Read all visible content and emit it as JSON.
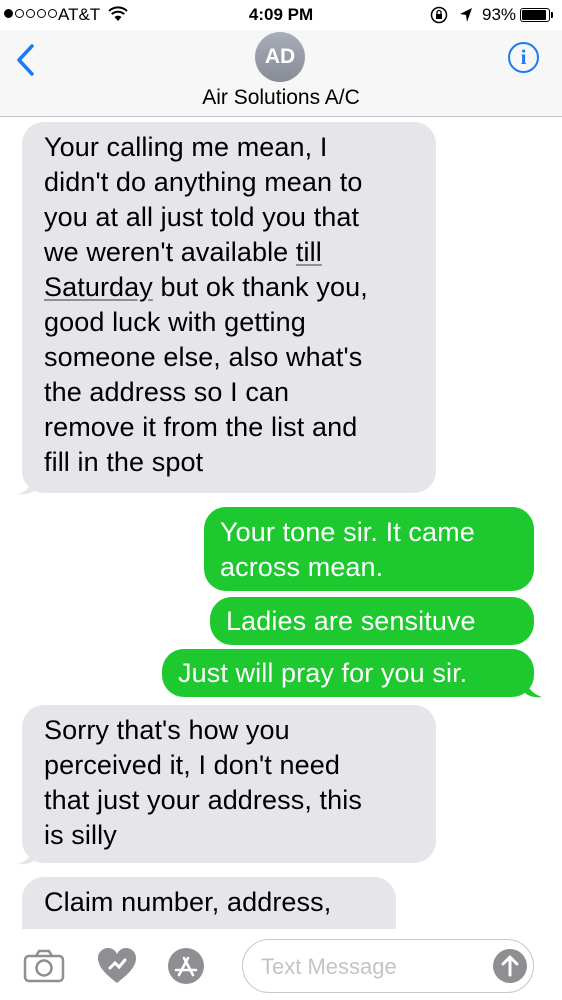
{
  "status_bar": {
    "carrier": "AT&T",
    "time": "4:09 PM",
    "battery_percent": "93%",
    "battery_level": 0.93,
    "signal_bars": 1
  },
  "header": {
    "avatar_initials": "AD",
    "contact_name": "Air Solutions A/C",
    "info_label": "i"
  },
  "messages": [
    {
      "direction": "incoming",
      "lines": [
        "Your calling me mean, I",
        "didn't do anything mean to",
        "you at all just told you that",
        "we weren't available till",
        "Saturday but ok thank you,",
        "good luck with getting",
        "someone else, also what's",
        "the address so I can",
        "remove it from the list and",
        "fill in the spot"
      ],
      "detected_date_text": "till Saturday"
    },
    {
      "direction": "outgoing",
      "lines": [
        "Your tone sir. It came",
        "across mean."
      ]
    },
    {
      "direction": "outgoing",
      "lines": [
        "Ladies are sensituve"
      ]
    },
    {
      "direction": "outgoing",
      "lines": [
        "Just will pray for you sir."
      ]
    },
    {
      "direction": "incoming",
      "lines": [
        "Sorry that's how you",
        "perceived it, I don't need",
        "that just your address, this",
        "is silly"
      ]
    },
    {
      "direction": "incoming",
      "lines": [
        "Claim number, address,"
      ]
    }
  ],
  "input_bar": {
    "placeholder": "Text Message"
  },
  "colors": {
    "incoming_bubble": "#e5e5ea",
    "outgoing_bubble": "#1ec930",
    "accent": "#1a7cf5",
    "header_bg": "#f7f7f8"
  }
}
